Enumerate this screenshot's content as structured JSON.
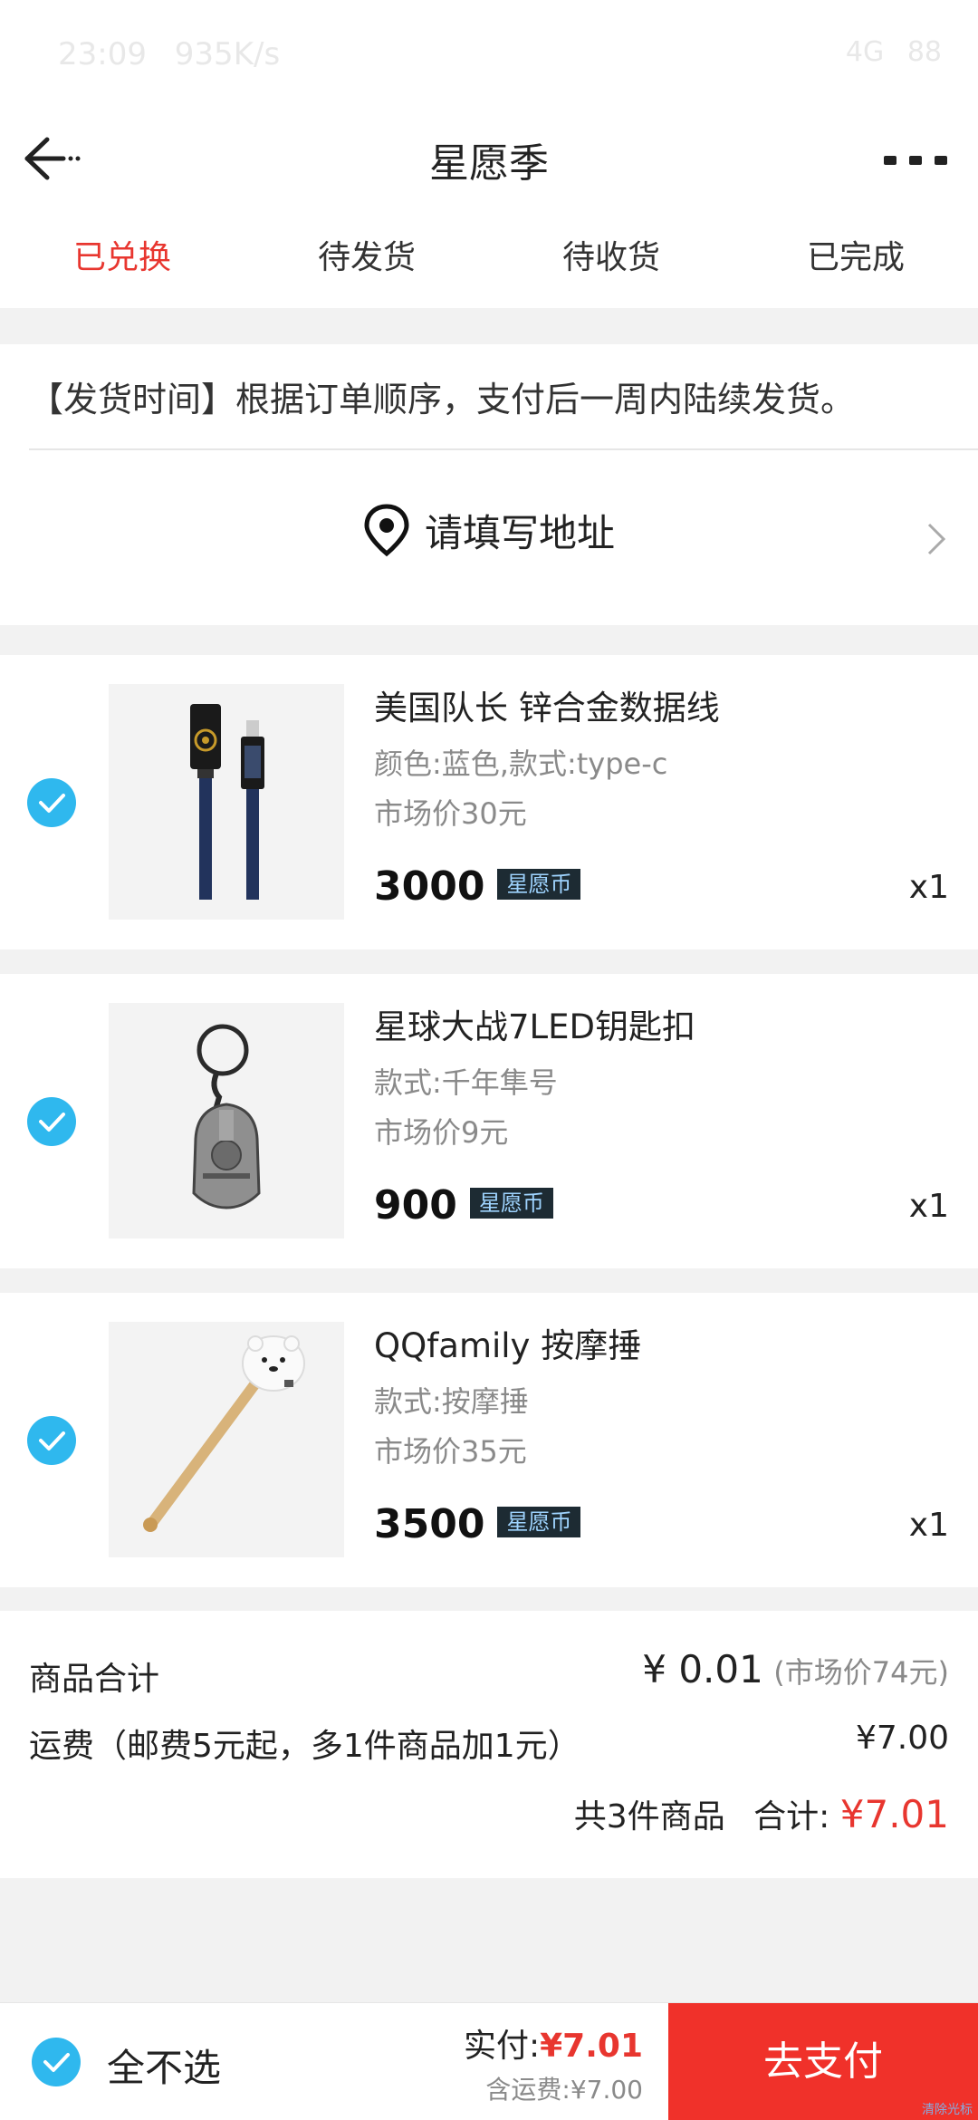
{
  "status": {
    "time": "23:09",
    "speed": "935K/s",
    "network": "4G",
    "battery": "88"
  },
  "nav": {
    "title": "星愿季"
  },
  "tabs": [
    "已兑换",
    "待发货",
    "待收货",
    "已完成"
  ],
  "notice": "【发货时间】根据订单顺序，支付后一周内陆续发货。",
  "address": {
    "label": "请填写地址"
  },
  "items": [
    {
      "title": "美国队长 锌合金数据线",
      "spec": "颜色:蓝色,款式:type-c",
      "market": "市场价30元",
      "price": "3000",
      "coin": "星愿币",
      "qty": "x1"
    },
    {
      "title": "星球大战7LED钥匙扣",
      "spec": "款式:千年隼号",
      "market": "市场价9元",
      "price": "900",
      "coin": "星愿币",
      "qty": "x1"
    },
    {
      "title": "QQfamily 按摩捶",
      "spec": "款式:按摩捶",
      "market": "市场价35元",
      "price": "3500",
      "coin": "星愿币",
      "qty": "x1"
    }
  ],
  "summary": {
    "goods_label": "商品合计",
    "goods_value": "¥ 0.01",
    "goods_market": "(市场价74元)",
    "shipping_label": "运费（邮费5元起，多1件商品加1元）",
    "shipping_value": "¥7.00",
    "count_label": "共3件商品",
    "total_label": "合计:",
    "total_value": "¥7.01"
  },
  "bottom": {
    "select_label": "全不选",
    "paid_label": "实付:",
    "paid_value": "¥7.01",
    "shipping_note": "含运费:¥7.00",
    "pay_label": "去支付",
    "corner_mark": "清除光标"
  },
  "colors": {
    "accent": "#e8362f",
    "check": "#2fb8ee",
    "pay_button": "#f0312a"
  }
}
